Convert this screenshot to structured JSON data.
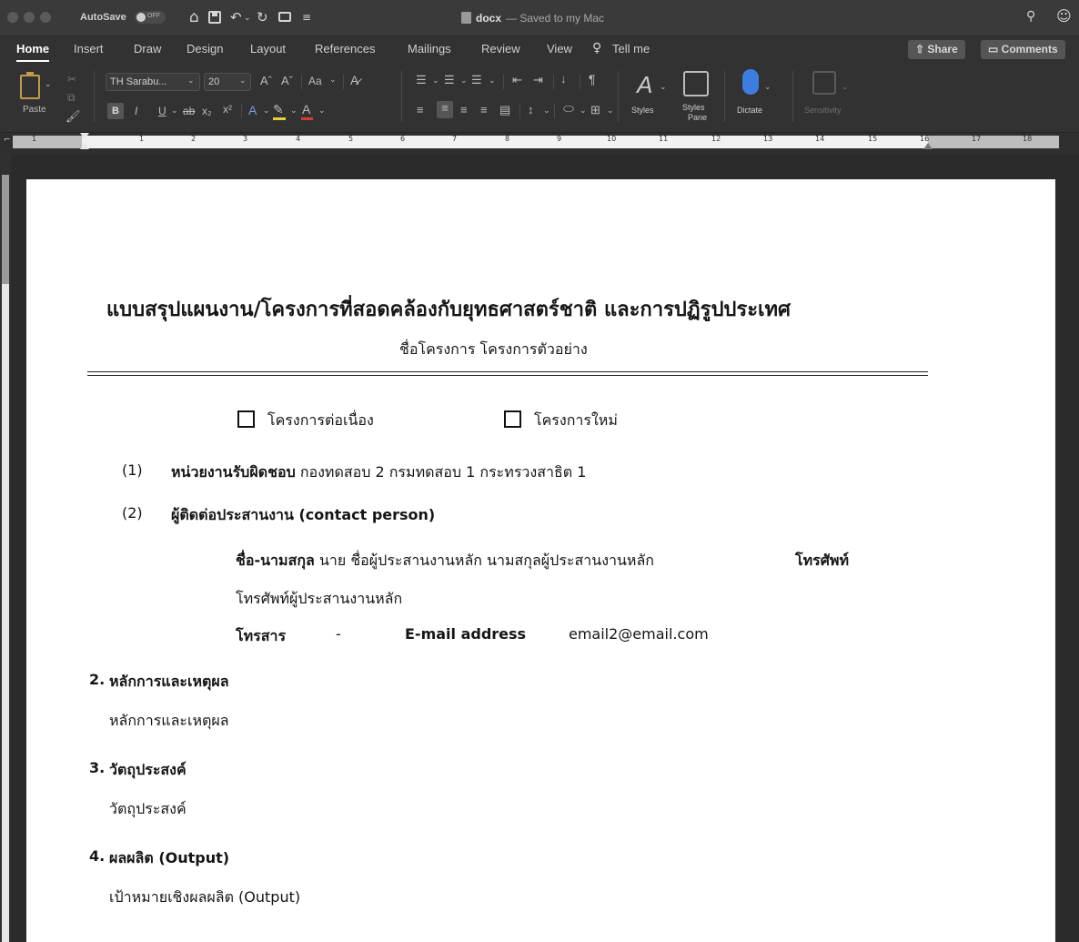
{
  "window": {
    "autosave_label": "AutoSave",
    "autosave_state": "OFF",
    "doc_name": "docx",
    "doc_status": "— Saved to my Mac"
  },
  "tabs": [
    "Home",
    "Insert",
    "Draw",
    "Design",
    "Layout",
    "References",
    "Mailings",
    "Review",
    "View"
  ],
  "tell_me": "Tell me",
  "share_label": "Share",
  "comments_label": "Comments",
  "ribbon": {
    "paste_label": "Paste",
    "font_name": "TH Sarabu...",
    "font_size": "20",
    "change_case": "Aa",
    "styles_label": "Styles",
    "styles_pane_line1": "Styles",
    "styles_pane_line2": "Pane",
    "dictate_label": "Dictate",
    "sensitivity_label": "Sensitivity"
  },
  "ruler_numbers": [
    "1",
    "1",
    "2",
    "3",
    "4",
    "5",
    "6",
    "7",
    "8",
    "9",
    "10",
    "11",
    "12",
    "13",
    "14",
    "15",
    "16",
    "17",
    "18"
  ],
  "document": {
    "title": "แบบสรุปแผนงาน/โครงการที่สอดคล้องกับยุทธศาสตร์ชาติ และการปฏิรูปประเทศ",
    "subtitle": "ชื่อโครงการ โครงการตัวอย่าง",
    "checkbox_continuing": "โครงการต่อเนื่อง",
    "checkbox_new": "โครงการใหม่",
    "item1_number": "(1)",
    "item1_label": "หน่วยงานรับผิดชอบ",
    "item1_value": "กองทดสอบ 2 กรมทดสอบ 1 กระทรวงสาธิต 1",
    "item2_number": "(2)",
    "item2_label": "ผู้ติดต่อประสานงาน (contact person)",
    "name_label": "ชื่อ-นามสกุล",
    "name_value": "นาย ชื่อผู้ประสานงานหลัก นามสกุลผู้ประสานงานหลัก",
    "phone_label": "โทรศัพท์",
    "phone_value": "โทรศัพท์ผู้ประสานงานหลัก",
    "fax_label": "โทรสาร",
    "fax_value": "-",
    "email_label": "E-mail address",
    "email_value": "email2@email.com",
    "s2_number": "2.",
    "s2_title": "หลักการและเหตุผล",
    "s2_body": "หลักการและเหตุผล",
    "s3_number": "3.",
    "s3_title": "วัตถุประสงค์",
    "s3_body": "วัตถุประสงค์",
    "s4_number": "4.",
    "s4_title": "ผลผลิต (Output)",
    "s4_body": "เป้าหมายเชิงผลผลิต (Output)"
  }
}
